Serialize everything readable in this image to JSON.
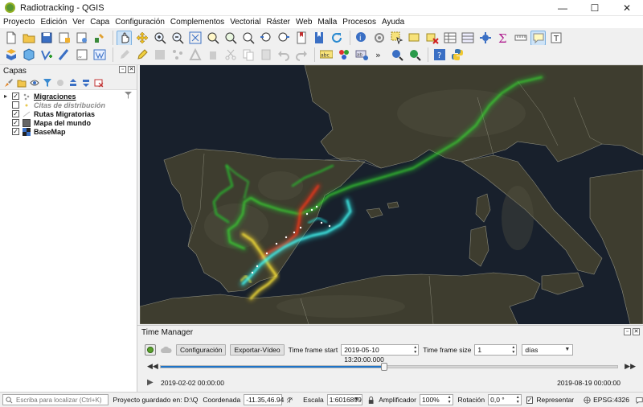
{
  "window": {
    "title": "Radiotracking - QGIS",
    "minimize": "—",
    "maximize": "☐",
    "close": "✕"
  },
  "menu": [
    "Proyecto",
    "Edición",
    "Ver",
    "Capa",
    "Configuración",
    "Complementos",
    "Vectorial",
    "Ráster",
    "Web",
    "Malla",
    "Procesos",
    "Ayuda"
  ],
  "layers_panel": {
    "title": "Capas",
    "layers": [
      {
        "name": "Migraciones",
        "checked": true,
        "expanded": false,
        "style": "underline"
      },
      {
        "name": "Citas de distribución",
        "checked": false,
        "style": "italic"
      },
      {
        "name": "Rutas Migratorias",
        "checked": true,
        "style": "bold"
      },
      {
        "name": "Mapa del mundo",
        "checked": true,
        "style": "bold"
      },
      {
        "name": "BaseMap",
        "checked": true,
        "style": "bold"
      }
    ]
  },
  "time_manager": {
    "title": "Time Manager",
    "settings_label": "Configuración",
    "export_label": "Exportar-Vídeo",
    "frame_start_label": "Time frame start",
    "frame_start_value": "2019-05-10 13:20:00.000",
    "frame_size_label": "Time frame size",
    "frame_size_value": "1",
    "unit_value": "días",
    "slider_position": 0.49,
    "start_time": "2019-02-02 00:00:00",
    "end_time": "2019-08-19 00:00:00"
  },
  "statusbar": {
    "locator_placeholder": "Escriba para localizar (Ctrl+K)",
    "project_saved": "Proyecto guardado en: D:\\Q",
    "coord_label": "Coordenada",
    "coord_value": "-11.35,46.94",
    "scale_label": "Escala",
    "scale_value": "1:6016899",
    "magnifier_label": "Amplificador",
    "magnifier_value": "100%",
    "rotation_label": "Rotación",
    "rotation_value": "0,0 °",
    "render_label": "Representar",
    "crs": "EPSG:4326"
  },
  "colors": {
    "route_green": "#27c22d",
    "route_red": "#ff2a18",
    "route_cyan": "#25f2ee",
    "route_yellow": "#ffe02a",
    "map_bg": "#161d28"
  }
}
